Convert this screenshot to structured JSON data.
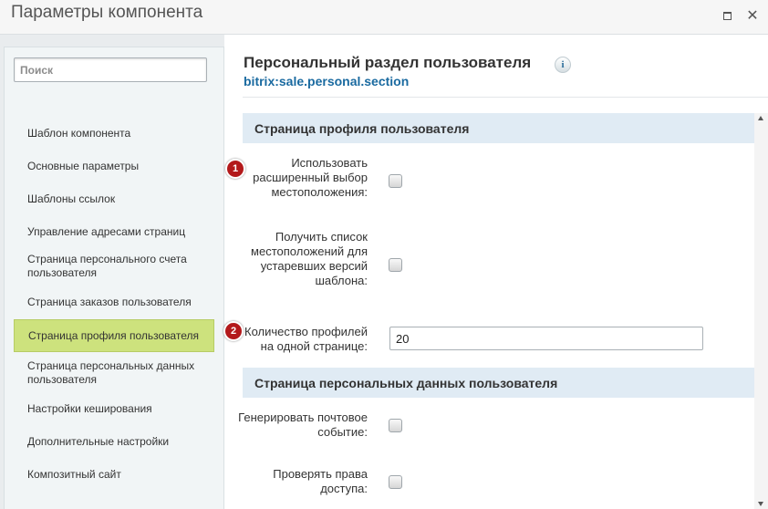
{
  "window": {
    "title": "Параметры компонента",
    "maximize_icon": "maximize-icon",
    "close_icon": "close-icon",
    "close_glyph": "✕"
  },
  "sidebar": {
    "search_placeholder": "Поиск",
    "items": [
      {
        "label": "Шаблон компонента"
      },
      {
        "label": "Основные параметры"
      },
      {
        "label": "Шаблоны ссылок"
      },
      {
        "label": "Управление адресами страниц"
      },
      {
        "label": "Страница персонального счета пользователя"
      },
      {
        "label": "Страница заказов пользователя"
      },
      {
        "label": "Страница профиля пользователя",
        "active": true
      },
      {
        "label": "Страница персональных данных пользователя"
      },
      {
        "label": "Настройки кеширования"
      },
      {
        "label": "Дополнительные настройки"
      },
      {
        "label": "Композитный сайт"
      }
    ],
    "active_color": "#cde27d"
  },
  "component": {
    "title": "Персональный раздел пользователя",
    "info_glyph": "i",
    "code": "bitrix:sale.personal.section"
  },
  "sections": [
    {
      "title": "Страница профиля пользователя",
      "fields": [
        {
          "label": "Использовать расширенный выбор местоположения:",
          "type": "checkbox",
          "checked": false
        },
        {
          "label": "Получить список местоположений для устаревших версий шаблона:",
          "type": "checkbox",
          "checked": false
        },
        {
          "label": "Количество профилей на одной странице:",
          "type": "text",
          "value": "20"
        }
      ]
    },
    {
      "title": "Страница персональных данных пользователя",
      "fields": [
        {
          "label": "Генерировать почтовое событие:",
          "type": "checkbox",
          "checked": false
        },
        {
          "label": "Проверять права доступа:",
          "type": "checkbox",
          "checked": false
        }
      ]
    }
  ],
  "badges": [
    {
      "number": "1"
    },
    {
      "number": "2"
    }
  ],
  "colors": {
    "badge": "#b3191b",
    "link": "#1a6aa0",
    "section_bg": "#e0ebf4"
  }
}
